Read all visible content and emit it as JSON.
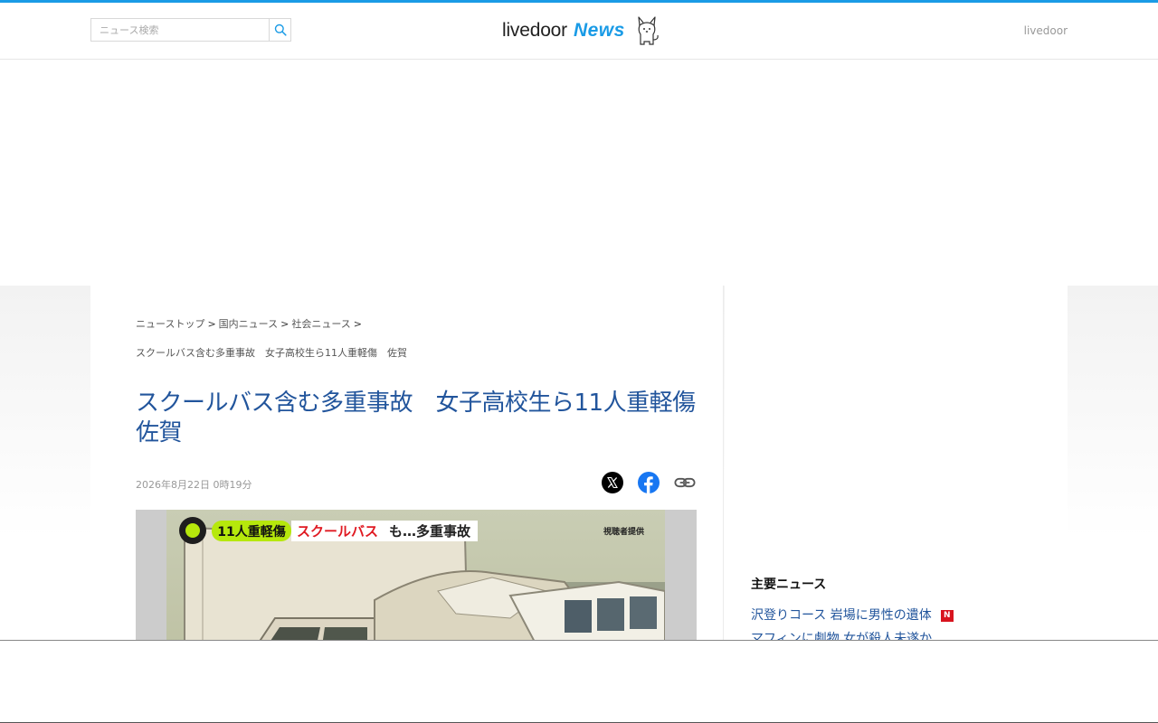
{
  "search": {
    "placeholder": "ニュース検索"
  },
  "logo": {
    "brand": "livedoor",
    "product": "News"
  },
  "header": {
    "right_link": "livedoor"
  },
  "breadcrumb": {
    "items": [
      "ニューストップ",
      "国内ニュース",
      "社会ニュース"
    ],
    "separator": ">",
    "current": "スクールバス含む多重事故　女子高校生ら11人重軽傷　佐賀"
  },
  "article": {
    "title": "スクールバス含む多重事故　女子高校生ら11人重軽傷　佐賀",
    "date": "2026年8月22日 0時19分",
    "image": {
      "badge_text": "11人重軽傷",
      "headline_red": "スクールバス",
      "headline_rest": "も…多重事故",
      "credit": "視聴者提供"
    }
  },
  "share": {
    "icons": [
      "x-icon",
      "facebook-icon",
      "link-icon"
    ]
  },
  "sidebar": {
    "heading": "主要ニュース",
    "items": [
      {
        "label": "沢登りコース 岩場に男性の遺体",
        "new": true,
        "badge": "N"
      },
      {
        "label": "マフィンに劇物 女が殺人未遂か",
        "new": false
      }
    ]
  },
  "colors": {
    "accent": "#1a9be6",
    "title": "#22559c",
    "badge_red": "#d8141e",
    "lime": "#b6e80c"
  }
}
